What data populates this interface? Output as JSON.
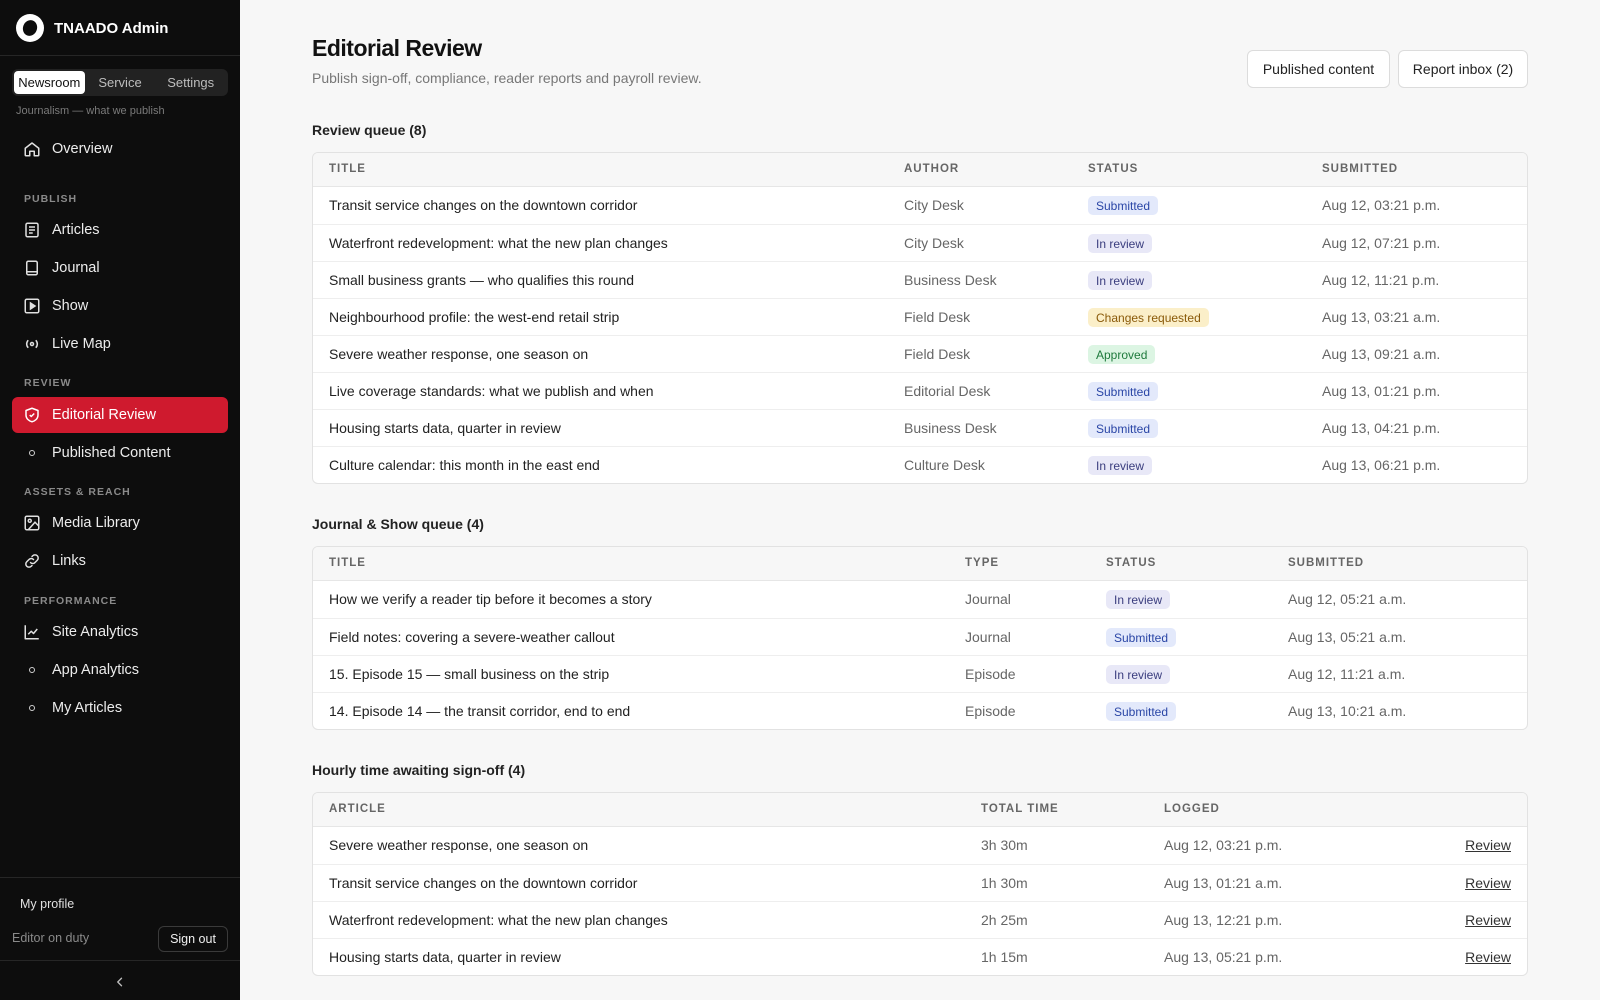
{
  "app": {
    "name": "TNAADO Admin"
  },
  "sidebar": {
    "segments": [
      {
        "label": "Newsroom",
        "active": true
      },
      {
        "label": "Service",
        "active": false
      },
      {
        "label": "Settings",
        "active": false
      }
    ],
    "segment_hint": "Journalism — what we publish",
    "overview": "Overview",
    "sections": {
      "publish": "PUBLISH",
      "review": "REVIEW",
      "assets": "ASSETS & REACH",
      "performance": "PERFORMANCE"
    },
    "items": {
      "articles": "Articles",
      "journal": "Journal",
      "show": "Show",
      "live_map": "Live Map",
      "editorial_review": "Editorial Review",
      "published_content": "Published Content",
      "media_library": "Media Library",
      "links": "Links",
      "site_analytics": "Site Analytics",
      "app_analytics": "App Analytics",
      "my_articles": "My Articles"
    },
    "profile": "My profile",
    "duty": "Editor on duty",
    "signout": "Sign out"
  },
  "header": {
    "title": "Editorial Review",
    "subtitle": "Publish sign-off, compliance, reader reports and payroll review.",
    "btn_published": "Published content",
    "btn_inbox": "Report inbox (2)"
  },
  "colors": {
    "accent": "#cf1a2e",
    "submitted_bg": "#e3e9fb",
    "submitted_fg": "#2a46a6",
    "inreview_bg": "#e8e8f7",
    "inreview_fg": "#3a3d7e",
    "changes_bg": "#fbefc9",
    "changes_fg": "#8a5a0a",
    "approved_bg": "#dcf5e3",
    "approved_fg": "#1e7a3c"
  },
  "review_queue": {
    "title": "Review queue (8)",
    "headers": [
      "TITLE",
      "AUTHOR",
      "STATUS",
      "SUBMITTED"
    ],
    "rows": [
      {
        "title": "Transit service changes on the downtown corridor",
        "author": "City Desk",
        "status": "Submitted",
        "status_key": "submitted",
        "submitted": "Aug 12, 03:21 p.m."
      },
      {
        "title": "Waterfront redevelopment: what the new plan changes",
        "author": "City Desk",
        "status": "In review",
        "status_key": "inreview",
        "submitted": "Aug 12, 07:21 p.m."
      },
      {
        "title": "Small business grants — who qualifies this round",
        "author": "Business Desk",
        "status": "In review",
        "status_key": "inreview",
        "submitted": "Aug 12, 11:21 p.m."
      },
      {
        "title": "Neighbourhood profile: the west-end retail strip",
        "author": "Field Desk",
        "status": "Changes requested",
        "status_key": "changes",
        "submitted": "Aug 13, 03:21 a.m."
      },
      {
        "title": "Severe weather response, one season on",
        "author": "Field Desk",
        "status": "Approved",
        "status_key": "approved",
        "submitted": "Aug 13, 09:21 a.m."
      },
      {
        "title": "Live coverage standards: what we publish and when",
        "author": "Editorial Desk",
        "status": "Submitted",
        "status_key": "submitted",
        "submitted": "Aug 13, 01:21 p.m."
      },
      {
        "title": "Housing starts data, quarter in review",
        "author": "Business Desk",
        "status": "Submitted",
        "status_key": "submitted",
        "submitted": "Aug 13, 04:21 p.m."
      },
      {
        "title": "Culture calendar: this month in the east end",
        "author": "Culture Desk",
        "status": "In review",
        "status_key": "inreview",
        "submitted": "Aug 13, 06:21 p.m."
      }
    ]
  },
  "journal_queue": {
    "title": "Journal & Show queue (4)",
    "headers": [
      "TITLE",
      "TYPE",
      "STATUS",
      "SUBMITTED"
    ],
    "rows": [
      {
        "title": "How we verify a reader tip before it becomes a story",
        "type": "Journal",
        "status": "In review",
        "status_key": "inreview",
        "submitted": "Aug 12, 05:21 a.m."
      },
      {
        "title": "Field notes: covering a severe-weather callout",
        "type": "Journal",
        "status": "Submitted",
        "status_key": "submitted",
        "submitted": "Aug 13, 05:21 a.m."
      },
      {
        "title": "15. Episode 15 — small business on the strip",
        "type": "Episode",
        "status": "In review",
        "status_key": "inreview",
        "submitted": "Aug 12, 11:21 a.m."
      },
      {
        "title": "14. Episode 14 — the transit corridor, end to end",
        "type": "Episode",
        "status": "Submitted",
        "status_key": "submitted",
        "submitted": "Aug 13, 10:21 a.m."
      }
    ]
  },
  "hourly": {
    "title": "Hourly time awaiting sign-off (4)",
    "headers": [
      "ARTICLE",
      "TOTAL TIME",
      "LOGGED"
    ],
    "action": "Review",
    "rows": [
      {
        "article": "Severe weather response, one season on",
        "total": "3h 30m",
        "logged": "Aug 12, 03:21 p.m."
      },
      {
        "article": "Transit service changes on the downtown corridor",
        "total": "1h 30m",
        "logged": "Aug 13, 01:21 a.m."
      },
      {
        "article": "Waterfront redevelopment: what the new plan changes",
        "total": "2h 25m",
        "logged": "Aug 13, 12:21 p.m."
      },
      {
        "article": "Housing starts data, quarter in review",
        "total": "1h 15m",
        "logged": "Aug 13, 05:21 p.m."
      }
    ]
  }
}
